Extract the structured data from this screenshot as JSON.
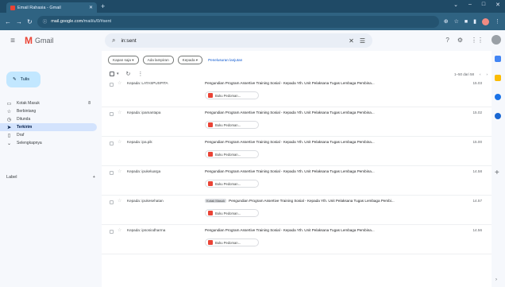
{
  "browser": {
    "tab_title": "Email Rahasia - Gmail",
    "url_domain": "mail.google.com",
    "url_path": "/mail/u/0/#sent"
  },
  "gmail": {
    "product_name": "Gmail",
    "search_query": "in:sent",
    "compose_label": "Tulis",
    "nav": [
      {
        "label": "Kotak Masuk",
        "icon": "inbox-icon",
        "count": "8",
        "active": false
      },
      {
        "label": "Berbintang",
        "icon": "star-icon",
        "count": "",
        "active": false
      },
      {
        "label": "Ditunda",
        "icon": "clock-icon",
        "count": "",
        "active": false
      },
      {
        "label": "Terkirim",
        "icon": "send-icon",
        "count": "",
        "active": true
      },
      {
        "label": "Draf",
        "icon": "draft-icon",
        "count": "",
        "active": false
      },
      {
        "label": "Selengkapnya",
        "icon": "chevron-down-icon",
        "count": "",
        "active": false
      }
    ],
    "labels_heading": "Label",
    "filter_chips": [
      "Kapan saja ▾",
      "Ada lampiran",
      "Kepada ▾"
    ],
    "filter_link": "Penelusuran lanjutan",
    "pager": "1–50 dari 58",
    "emails": [
      {
        "sender": "Kepada: LATASPUSPITA",
        "subject": "Pengundian Program Assertive Training Sosial - Kepada Yth. Unit Pelaksana Tugas Lembaga Pembina...",
        "inbox_tag": "",
        "attachment": "Buku Pedoman...",
        "time": "15.03"
      },
      {
        "sender": "Kepada: ipamantapa",
        "subject": "Pengundian Program Assertive Training Sosial - Kepada Yth. Unit Pelaksana Tugas Lembaga Pembina...",
        "inbox_tag": "",
        "attachment": "Buku Pedoman...",
        "time": "15.02"
      },
      {
        "sender": "Kepada: ipa.pik",
        "subject": "Pengundian Program Assertive Training Sosial - Kepada Yth. Unit Pelaksana Tugas Lembaga Pembina...",
        "inbox_tag": "",
        "attachment": "Buku Pedoman...",
        "time": "15.00"
      },
      {
        "sender": "Kepada: ipukeluarga",
        "subject": "Pengundian Program Assertive Training Sosial - Kepada Yth. Unit Pelaksana Tugas Lembaga Pembina...",
        "inbox_tag": "",
        "attachment": "Buku Pedoman...",
        "time": "14.58"
      },
      {
        "sender": "Kepada: ipukesehatan",
        "subject": "Pengundian Program Assertive Training Sosial - Kepada Yth. Unit Pelaksana Tugas Lembaga Pembi...",
        "inbox_tag": "Kotak Masuk",
        "attachment": "Buku Pedoman...",
        "time": "14.57"
      },
      {
        "sender": "Kepada: ipsosiodharma",
        "subject": "Pengundian Program Assertive Training Sosial - Kepada Yth. Unit Pelaksana Tugas Lembaga Pembina...",
        "inbox_tag": "",
        "attachment": "Buku Pedoman...",
        "time": "14.56"
      }
    ]
  },
  "colors": {
    "chrome_frame": "#1f4a66",
    "gmail_bg": "#f6f8fc",
    "compose_bg": "#c2e7ff",
    "active_nav": "#d3e3fd",
    "pdf_red": "#ea4335"
  }
}
